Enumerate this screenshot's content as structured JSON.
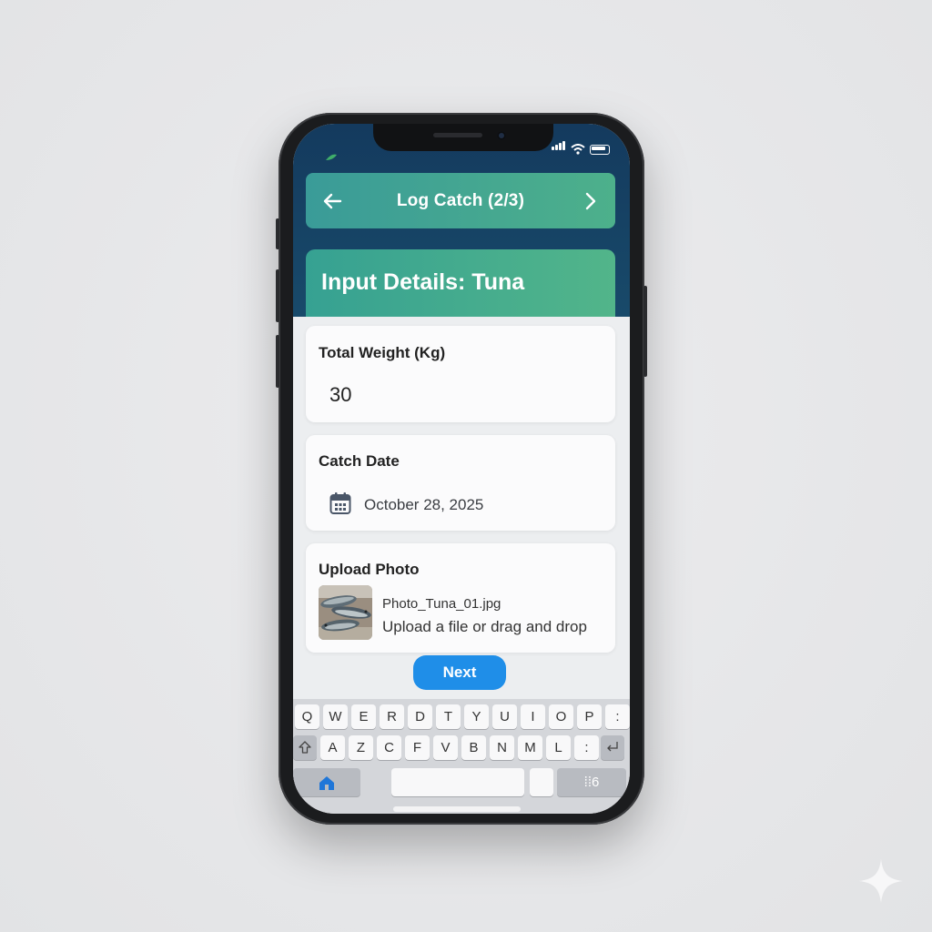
{
  "header": {
    "title": "Log Catch (2/3)",
    "back_icon": "arrow-left-icon",
    "forward_icon": "chevron-right-icon"
  },
  "details": {
    "title": "Input Details: Tuna"
  },
  "weight": {
    "label": "Total Weight (Kg)",
    "value": "30"
  },
  "catch_date": {
    "label": "Catch Date",
    "icon": "calendar-icon",
    "value": "October 28, 2025"
  },
  "photo": {
    "label": "Upload Photo",
    "file_name": "Photo_Tuna_01.jpg",
    "hint": "Upload a file or drag and drop"
  },
  "next_label": "Next",
  "keyboard": {
    "row1": [
      "Q",
      "W",
      "E",
      "R",
      "D",
      "T",
      "Y",
      "U",
      "I",
      "O",
      "P",
      ":"
    ],
    "row2": [
      "A",
      "Z",
      "C",
      "F",
      "V",
      "B",
      "N",
      "M",
      "L",
      ":"
    ],
    "shift_icon": "shift-icon",
    "return_icon": "return-icon",
    "home_icon": "home-icon",
    "globe_key": "⁞⁞6"
  },
  "colors": {
    "accent_blue": "#1f8ee8",
    "header_start": "#3a9b98",
    "header_end": "#4db08b",
    "screen_dark": "#143a5e"
  }
}
